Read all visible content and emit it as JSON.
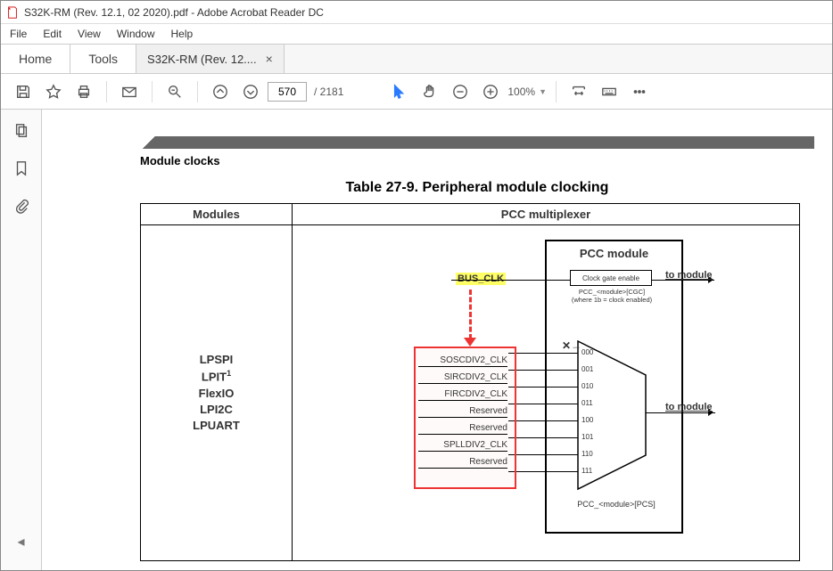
{
  "title_bar": {
    "text": "S32K-RM (Rev. 12.1, 02 2020).pdf - Adobe Acrobat Reader DC"
  },
  "menu": {
    "file": "File",
    "edit": "Edit",
    "view": "View",
    "window": "Window",
    "help": "Help"
  },
  "tabs": {
    "home": "Home",
    "tools": "Tools",
    "doc": "S32K-RM (Rev. 12...."
  },
  "toolbar": {
    "page_current": "570",
    "page_total": "/  2181",
    "zoom": "100%"
  },
  "document": {
    "section_name": "Module clocks",
    "table_caption": "Table 27-9.   Peripheral module clocking",
    "col_modules": "Modules",
    "col_pcc": "PCC multiplexer",
    "modules": {
      "m0": "LPSPI",
      "m1a": "LPIT",
      "m1b": "1",
      "m2": "FlexIO",
      "m3": "LPI2C",
      "m4": "LPUART"
    },
    "diagram": {
      "bus_clk": "BUS_CLK",
      "to_module": "to module",
      "pcc_module": "PCC module",
      "clock_gate": "Clock gate enable",
      "cgc_label_1": "PCC_<module>[CGC]",
      "cgc_label_2": "(where 1b = clock enabled)",
      "pcs_label": "PCC_<module>[PCS]",
      "clk0": "SOSCDIV2_CLK",
      "clk1": "SIRCDIV2_CLK",
      "clk2": "FIRCDIV2_CLK",
      "clk3": "Reserved",
      "clk4": "Reserved",
      "clk5": "SPLLDIV2_CLK",
      "clk6": "Reserved",
      "code0": "000",
      "code1": "001",
      "code2": "010",
      "code3": "011",
      "code4": "100",
      "code5": "101",
      "code6": "110",
      "code7": "111"
    }
  }
}
